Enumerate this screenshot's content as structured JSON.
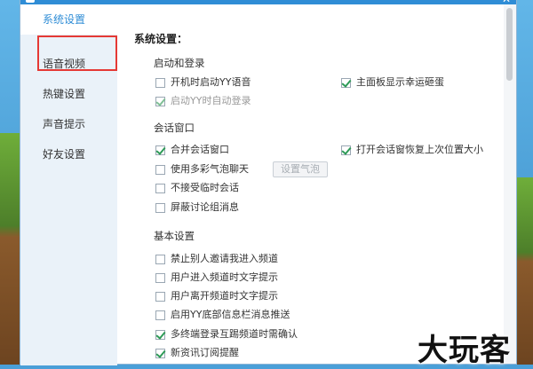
{
  "window": {
    "title": "设置"
  },
  "sidebar": {
    "items": [
      {
        "label": "系统设置",
        "active": true
      },
      {
        "label": "语音视频",
        "active": false
      },
      {
        "label": "热键设置",
        "active": false
      },
      {
        "label": "声音提示",
        "active": false
      },
      {
        "label": "好友设置",
        "active": false
      }
    ]
  },
  "main": {
    "heading": "系统设置：",
    "sections": {
      "startup": {
        "title": "启动和登录",
        "options": [
          {
            "label": "开机时启动YY语音",
            "checked": false
          },
          {
            "label": "主面板显示幸运砸蛋",
            "checked": true
          },
          {
            "label": "启动YY时自动登录",
            "checked": true,
            "disabled": true
          }
        ]
      },
      "chat": {
        "title": "会话窗口",
        "options": [
          {
            "label": "合并会话窗口",
            "checked": true
          },
          {
            "label": "打开会话窗恢复上次位置大小",
            "checked": true
          },
          {
            "label": "使用多彩气泡聊天",
            "checked": false
          },
          {
            "label": "不接受临时会话",
            "checked": false
          },
          {
            "label": "屏蔽讨论组消息",
            "checked": false
          }
        ],
        "bubble_button": "设置气泡"
      },
      "basic": {
        "title": "基本设置",
        "options": [
          {
            "label": "禁止别人邀请我进入频道",
            "checked": false
          },
          {
            "label": "用户进入频道时文字提示",
            "checked": false
          },
          {
            "label": "用户离开频道时文字提示",
            "checked": false
          },
          {
            "label": "启用YY底部信息栏消息推送",
            "checked": false
          },
          {
            "label": "多终端登录互踢频道时需确认",
            "checked": true
          },
          {
            "label": "新资讯订阅提醒",
            "checked": true
          }
        ]
      }
    }
  },
  "watermark": {
    "text": "大玩客"
  },
  "colors": {
    "accent": "#2f8dd6",
    "check": "#2e9b57",
    "highlight": "#e53935"
  }
}
